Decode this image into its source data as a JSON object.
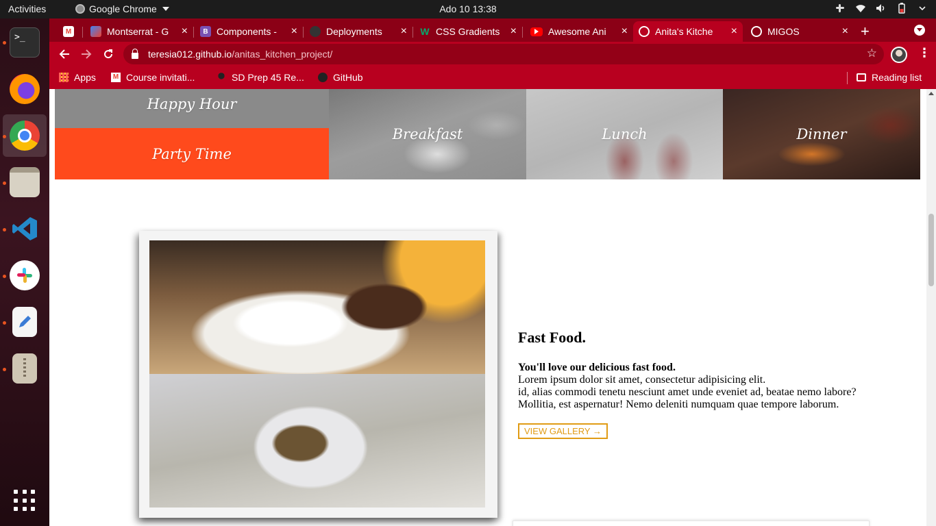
{
  "system": {
    "activities": "Activities",
    "app_name": "Google Chrome",
    "clock": "Ado 10  13:38"
  },
  "tabs": [
    {
      "title": "",
      "favicon": "gmail-icon",
      "color": "#ea4335"
    },
    {
      "title": "Montserrat - G",
      "favicon": "google-fonts-icon",
      "color": "#4285f4"
    },
    {
      "title": "Components -",
      "favicon": "bootstrap-icon",
      "color": "#7952b3"
    },
    {
      "title": "Deployments",
      "favicon": "github-icon",
      "color": "#333333"
    },
    {
      "title": "CSS Gradients",
      "favicon": "w3schools-icon",
      "color": "#04aa6d"
    },
    {
      "title": "Awesome Ani",
      "favicon": "youtube-icon",
      "color": "#ff0000"
    },
    {
      "title": "Anita's Kitche",
      "favicon": "globe-icon",
      "color": "#ffffff"
    },
    {
      "title": "MIGOS",
      "favicon": "globe-icon",
      "color": "#ffffff"
    }
  ],
  "address": {
    "host": "teresia012.github.io",
    "path": "/anitas_kitchen_project/"
  },
  "bookmarks": {
    "apps": "Apps",
    "course": "Course invitati...",
    "sdprep": "SD Prep 45 Re...",
    "github": "GitHub",
    "reading_list": "Reading list"
  },
  "page": {
    "tiles": {
      "happy_hour": "Happy Hour",
      "party_time": "Party Time",
      "breakfast": "Breakfast",
      "lunch": "Lunch",
      "dinner": "Dinner"
    },
    "section": {
      "title": "Fast Food.",
      "lead": "You'll love our delicious fast food.",
      "line1": "Lorem ipsum dolor sit amet, consectetur adipisicing elit.",
      "line2": "id, alias commodi tenetu nesciunt amet unde eveniet ad, beatae nemo labore?",
      "line3": "Mollitia, est aspernatur! Nemo deleniti numquam quae tempore laborum.",
      "button": "VIEW GALLERY →"
    }
  },
  "colors": {
    "accent_orange": "#ff4a1c",
    "chrome_theme": "#b8001f",
    "button_gold": "#e09b14"
  }
}
